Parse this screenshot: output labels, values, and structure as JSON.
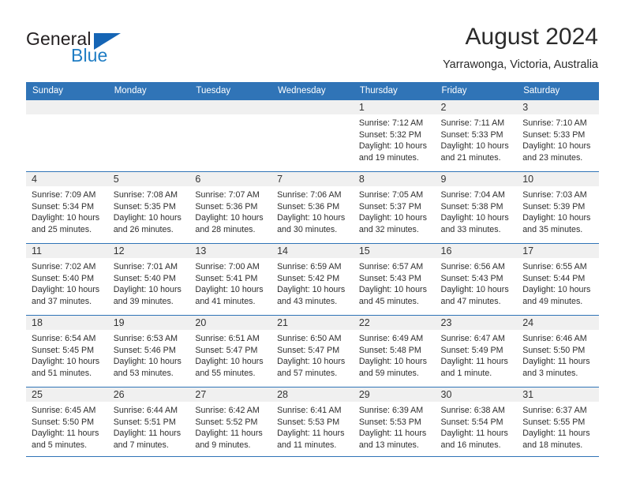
{
  "brand": {
    "name_top": "General",
    "name_bottom": "Blue",
    "triangle_icon": "triangle-icon",
    "color_top": "#231f20",
    "color_bottom": "#1f7dc4",
    "triangle_color": "#1565b5"
  },
  "header": {
    "title": "August 2024",
    "subtitle": "Yarrawonga, Victoria, Australia"
  },
  "theme": {
    "header_bg": "#3074b7",
    "header_text": "#ffffff",
    "daynum_band_bg": "#f0f0f0",
    "grid_line": "#3074b7",
    "body_text": "#2e2e2e"
  },
  "weekday_headers": [
    "Sunday",
    "Monday",
    "Tuesday",
    "Wednesday",
    "Thursday",
    "Friday",
    "Saturday"
  ],
  "weeks": [
    [
      {
        "day": "",
        "lines": []
      },
      {
        "day": "",
        "lines": []
      },
      {
        "day": "",
        "lines": []
      },
      {
        "day": "",
        "lines": []
      },
      {
        "day": "1",
        "lines": [
          "Sunrise: 7:12 AM",
          "Sunset: 5:32 PM",
          "Daylight: 10 hours",
          "and 19 minutes."
        ]
      },
      {
        "day": "2",
        "lines": [
          "Sunrise: 7:11 AM",
          "Sunset: 5:33 PM",
          "Daylight: 10 hours",
          "and 21 minutes."
        ]
      },
      {
        "day": "3",
        "lines": [
          "Sunrise: 7:10 AM",
          "Sunset: 5:33 PM",
          "Daylight: 10 hours",
          "and 23 minutes."
        ]
      }
    ],
    [
      {
        "day": "4",
        "lines": [
          "Sunrise: 7:09 AM",
          "Sunset: 5:34 PM",
          "Daylight: 10 hours",
          "and 25 minutes."
        ]
      },
      {
        "day": "5",
        "lines": [
          "Sunrise: 7:08 AM",
          "Sunset: 5:35 PM",
          "Daylight: 10 hours",
          "and 26 minutes."
        ]
      },
      {
        "day": "6",
        "lines": [
          "Sunrise: 7:07 AM",
          "Sunset: 5:36 PM",
          "Daylight: 10 hours",
          "and 28 minutes."
        ]
      },
      {
        "day": "7",
        "lines": [
          "Sunrise: 7:06 AM",
          "Sunset: 5:36 PM",
          "Daylight: 10 hours",
          "and 30 minutes."
        ]
      },
      {
        "day": "8",
        "lines": [
          "Sunrise: 7:05 AM",
          "Sunset: 5:37 PM",
          "Daylight: 10 hours",
          "and 32 minutes."
        ]
      },
      {
        "day": "9",
        "lines": [
          "Sunrise: 7:04 AM",
          "Sunset: 5:38 PM",
          "Daylight: 10 hours",
          "and 33 minutes."
        ]
      },
      {
        "day": "10",
        "lines": [
          "Sunrise: 7:03 AM",
          "Sunset: 5:39 PM",
          "Daylight: 10 hours",
          "and 35 minutes."
        ]
      }
    ],
    [
      {
        "day": "11",
        "lines": [
          "Sunrise: 7:02 AM",
          "Sunset: 5:40 PM",
          "Daylight: 10 hours",
          "and 37 minutes."
        ]
      },
      {
        "day": "12",
        "lines": [
          "Sunrise: 7:01 AM",
          "Sunset: 5:40 PM",
          "Daylight: 10 hours",
          "and 39 minutes."
        ]
      },
      {
        "day": "13",
        "lines": [
          "Sunrise: 7:00 AM",
          "Sunset: 5:41 PM",
          "Daylight: 10 hours",
          "and 41 minutes."
        ]
      },
      {
        "day": "14",
        "lines": [
          "Sunrise: 6:59 AM",
          "Sunset: 5:42 PM",
          "Daylight: 10 hours",
          "and 43 minutes."
        ]
      },
      {
        "day": "15",
        "lines": [
          "Sunrise: 6:57 AM",
          "Sunset: 5:43 PM",
          "Daylight: 10 hours",
          "and 45 minutes."
        ]
      },
      {
        "day": "16",
        "lines": [
          "Sunrise: 6:56 AM",
          "Sunset: 5:43 PM",
          "Daylight: 10 hours",
          "and 47 minutes."
        ]
      },
      {
        "day": "17",
        "lines": [
          "Sunrise: 6:55 AM",
          "Sunset: 5:44 PM",
          "Daylight: 10 hours",
          "and 49 minutes."
        ]
      }
    ],
    [
      {
        "day": "18",
        "lines": [
          "Sunrise: 6:54 AM",
          "Sunset: 5:45 PM",
          "Daylight: 10 hours",
          "and 51 minutes."
        ]
      },
      {
        "day": "19",
        "lines": [
          "Sunrise: 6:53 AM",
          "Sunset: 5:46 PM",
          "Daylight: 10 hours",
          "and 53 minutes."
        ]
      },
      {
        "day": "20",
        "lines": [
          "Sunrise: 6:51 AM",
          "Sunset: 5:47 PM",
          "Daylight: 10 hours",
          "and 55 minutes."
        ]
      },
      {
        "day": "21",
        "lines": [
          "Sunrise: 6:50 AM",
          "Sunset: 5:47 PM",
          "Daylight: 10 hours",
          "and 57 minutes."
        ]
      },
      {
        "day": "22",
        "lines": [
          "Sunrise: 6:49 AM",
          "Sunset: 5:48 PM",
          "Daylight: 10 hours",
          "and 59 minutes."
        ]
      },
      {
        "day": "23",
        "lines": [
          "Sunrise: 6:47 AM",
          "Sunset: 5:49 PM",
          "Daylight: 11 hours",
          "and 1 minute."
        ]
      },
      {
        "day": "24",
        "lines": [
          "Sunrise: 6:46 AM",
          "Sunset: 5:50 PM",
          "Daylight: 11 hours",
          "and 3 minutes."
        ]
      }
    ],
    [
      {
        "day": "25",
        "lines": [
          "Sunrise: 6:45 AM",
          "Sunset: 5:50 PM",
          "Daylight: 11 hours",
          "and 5 minutes."
        ]
      },
      {
        "day": "26",
        "lines": [
          "Sunrise: 6:44 AM",
          "Sunset: 5:51 PM",
          "Daylight: 11 hours",
          "and 7 minutes."
        ]
      },
      {
        "day": "27",
        "lines": [
          "Sunrise: 6:42 AM",
          "Sunset: 5:52 PM",
          "Daylight: 11 hours",
          "and 9 minutes."
        ]
      },
      {
        "day": "28",
        "lines": [
          "Sunrise: 6:41 AM",
          "Sunset: 5:53 PM",
          "Daylight: 11 hours",
          "and 11 minutes."
        ]
      },
      {
        "day": "29",
        "lines": [
          "Sunrise: 6:39 AM",
          "Sunset: 5:53 PM",
          "Daylight: 11 hours",
          "and 13 minutes."
        ]
      },
      {
        "day": "30",
        "lines": [
          "Sunrise: 6:38 AM",
          "Sunset: 5:54 PM",
          "Daylight: 11 hours",
          "and 16 minutes."
        ]
      },
      {
        "day": "31",
        "lines": [
          "Sunrise: 6:37 AM",
          "Sunset: 5:55 PM",
          "Daylight: 11 hours",
          "and 18 minutes."
        ]
      }
    ]
  ]
}
